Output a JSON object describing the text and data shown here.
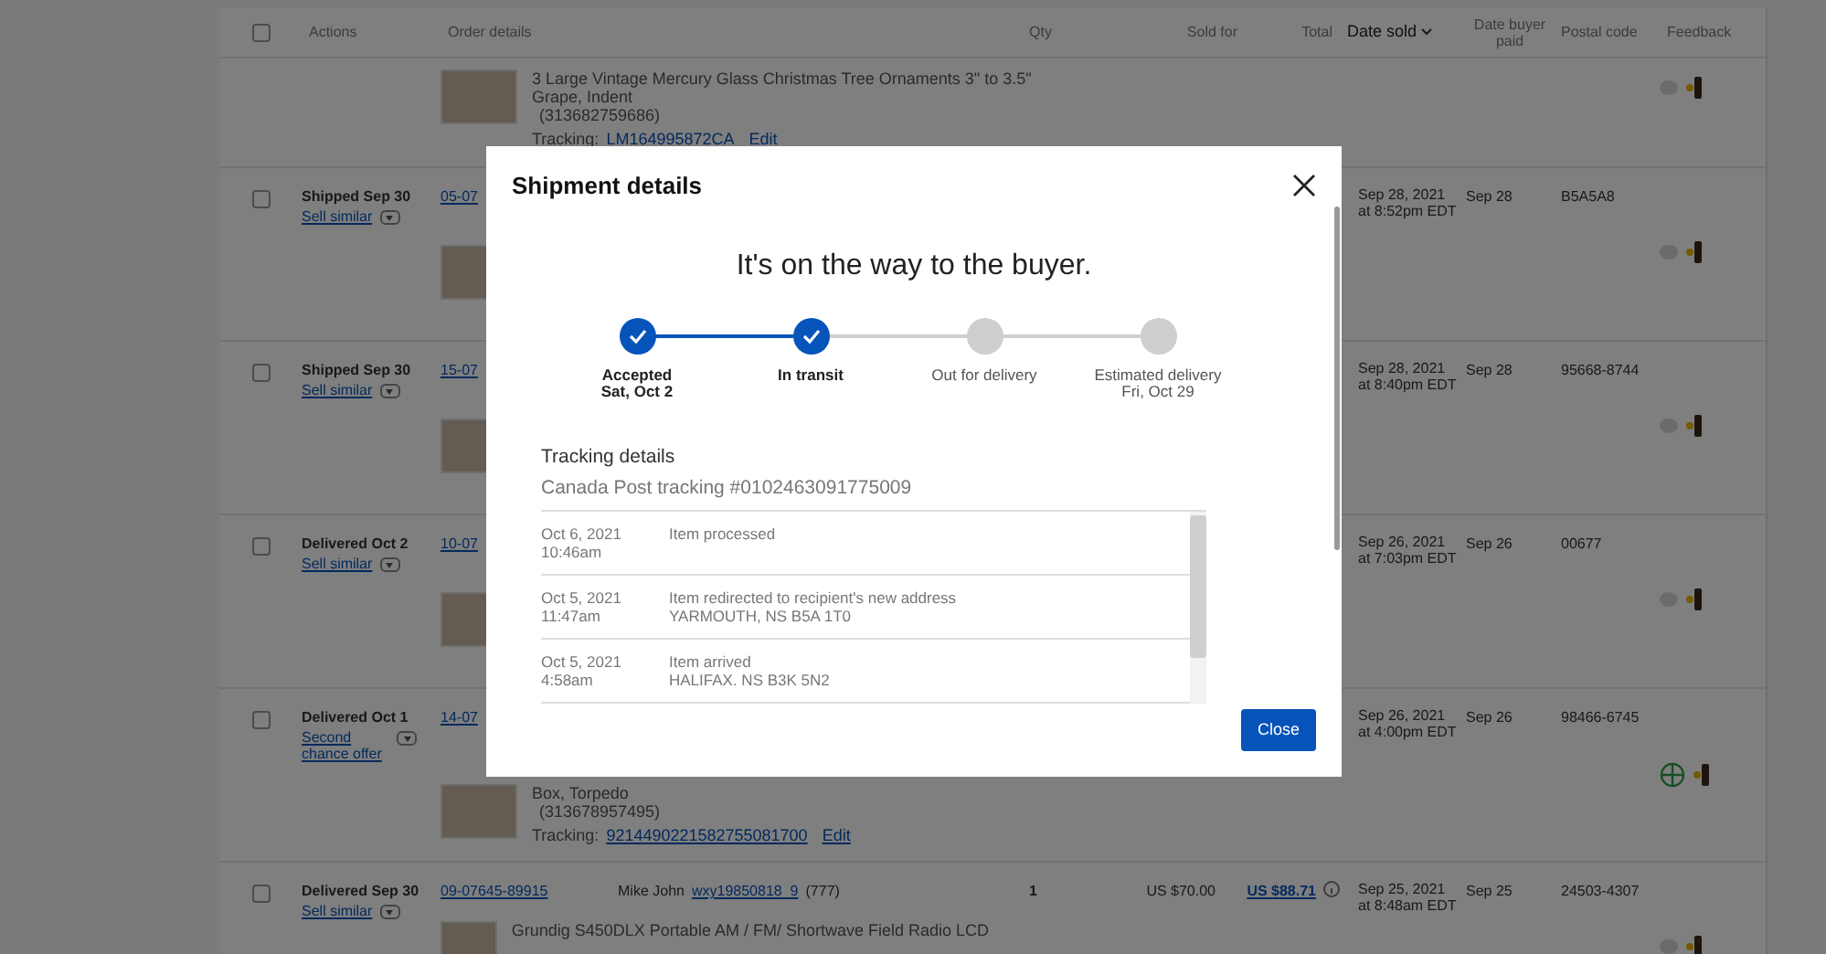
{
  "table": {
    "select_all_checked": false,
    "columns": [
      {
        "label": "Actions",
        "sorted": false
      },
      {
        "label": "Order details",
        "sorted": false
      },
      {
        "label": "Qty",
        "sorted": false
      },
      {
        "label": "Sold for",
        "sorted": false
      },
      {
        "label": "Total",
        "sorted": false
      },
      {
        "label": "Date sold",
        "sorted": true
      },
      {
        "label": "Date buyer paid",
        "sorted": false
      },
      {
        "label": "Postal code",
        "sorted": false
      },
      {
        "label": "Feedback",
        "sorted": false
      }
    ],
    "rows": [
      {
        "kind": "item",
        "item": {
          "lines": [
            "3 Large Vintage Mercury Glass Christmas Tree Ornaments 3\" to 3.5\"",
            "Grape, Indent"
          ],
          "item_id": "(313682759686)",
          "tracking_label": "Tracking:",
          "tracking": "LM164995872CA",
          "edit": "Edit"
        },
        "feedback_positive": false
      },
      {
        "kind": "order",
        "checked": false,
        "status": "Shipped Sep 30",
        "action": "Sell similar",
        "order_number": "05-07",
        "date_sold": "Sep 28, 2021 at 8:52pm EDT",
        "date_paid": "Sep 28",
        "postal": "B5A5A8",
        "feedback_positive": false
      },
      {
        "kind": "order",
        "checked": false,
        "status": "Shipped Sep 30",
        "action": "Sell similar",
        "order_number": "15-07",
        "date_sold": "Sep 28, 2021 at 8:40pm EDT",
        "date_paid": "Sep 28",
        "postal": "95668-8744",
        "feedback_positive": false
      },
      {
        "kind": "order",
        "checked": false,
        "status": "Delivered Oct 2",
        "action": "Sell similar",
        "order_number": "10-07",
        "date_sold": "Sep 26, 2021 at 7:03pm EDT",
        "date_paid": "Sep 26",
        "postal": "00677",
        "feedback_positive": false
      },
      {
        "kind": "order",
        "checked": false,
        "status": "Delivered Oct 1",
        "action": "Second chance offer",
        "order_number": "14-07",
        "date_sold": "Sep 26, 2021 at 4:00pm EDT",
        "date_paid": "Sep 26",
        "postal": "98466-6745",
        "item": {
          "lines": [
            "Box, Torpedo"
          ],
          "item_id": "(313678957495)",
          "tracking_label": "Tracking:",
          "tracking": "9214490221582755081700",
          "edit": "Edit"
        },
        "feedback_positive": true
      },
      {
        "kind": "order",
        "checked": false,
        "status": "Delivered Sep 30",
        "action": "Sell similar",
        "order_number": "09-07645-89915",
        "buyer_name": "Mike John",
        "buyer_id": "wxy19850818_9",
        "buyer_score": "(777)",
        "qty": "1",
        "sold_for": "US $70.00",
        "total": "US $88.71",
        "date_sold": "Sep 25, 2021 at 8:48am EDT",
        "date_paid": "Sep 25",
        "postal": "24503-4307",
        "item": {
          "lines": [
            "Grundig S450DLX Portable AM / FM/ Shortwave Field Radio LCD"
          ]
        },
        "feedback_positive": false
      }
    ]
  },
  "modal": {
    "title": "Shipment details",
    "headline": "It's on the way to the buyer.",
    "steps": [
      {
        "label": "Accepted",
        "sublabel": "Sat, Oct 2",
        "done": true
      },
      {
        "label": "In transit",
        "done": true
      },
      {
        "label": "Out for delivery",
        "done": false
      },
      {
        "label": "Estimated delivery",
        "sublabel": "Fri, Oct 29",
        "done": false
      }
    ],
    "tracking_title": "Tracking details",
    "tracking_number": "Canada Post tracking #0102463091775009",
    "events": [
      {
        "date": "Oct 6, 2021",
        "time": "10:46am",
        "event": "Item processed"
      },
      {
        "date": "Oct 5, 2021",
        "time": "11:47am",
        "event": "Item redirected to recipient's new address",
        "location": "YARMOUTH, NS B5A 1T0"
      },
      {
        "date": "Oct 5, 2021",
        "time": "4:58am",
        "event": "Item arrived",
        "location": "HALIFAX. NS B3K 5N2"
      }
    ],
    "close_button": "Close"
  }
}
